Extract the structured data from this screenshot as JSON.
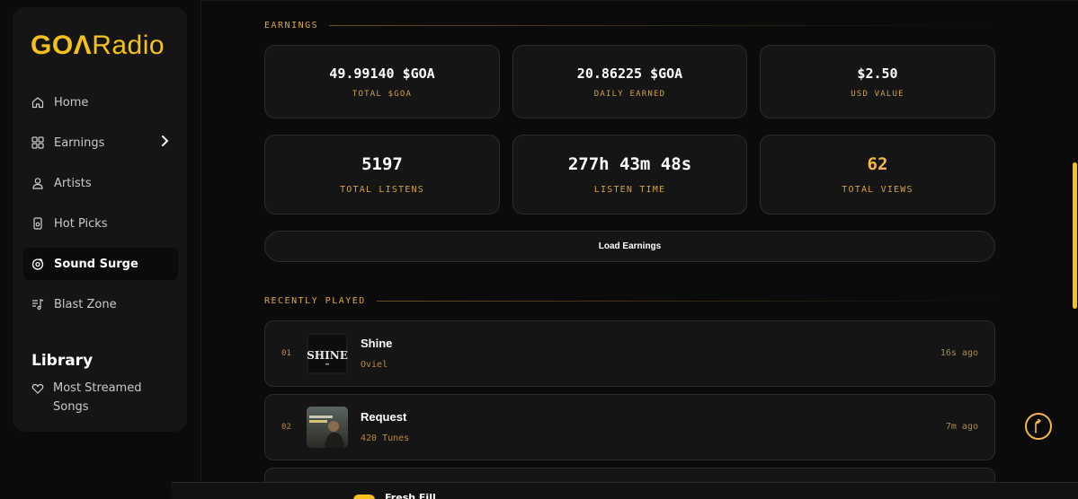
{
  "brand": {
    "logo_prefix": "GO",
    "logo_glyph": "Λ",
    "logo_suffix": "Radio",
    "accent": "#f6c21a"
  },
  "sidebar": {
    "items": [
      {
        "label": "Home",
        "icon": "home-icon"
      },
      {
        "label": "Earnings",
        "icon": "grid-icon",
        "chevron": true
      },
      {
        "label": "Artists",
        "icon": "user-icon"
      },
      {
        "label": "Hot Picks",
        "icon": "device-icon"
      },
      {
        "label": "Sound Surge",
        "icon": "disc-icon",
        "active": true
      },
      {
        "label": "Blast Zone",
        "icon": "music-list-icon"
      }
    ],
    "library_title": "Library",
    "library_items": [
      {
        "label": "Most Streamed Songs",
        "icon": "heart-icon"
      }
    ]
  },
  "earnings": {
    "header": "EARNINGS",
    "stats_row1": [
      {
        "value": "49.99140 $GOA",
        "label": "TOTAL $GOA"
      },
      {
        "value": "20.86225 $GOA",
        "label": "DAILY EARNED"
      },
      {
        "value": "$2.50",
        "label": "USD VALUE"
      }
    ],
    "stats_row2": [
      {
        "value": "5197",
        "label": "TOTAL LISTENS"
      },
      {
        "value": "277h 43m 48s",
        "label": "LISTEN TIME"
      },
      {
        "value": "62",
        "label": "TOTAL VIEWS"
      }
    ],
    "load_button": "Load Earnings"
  },
  "recently_played": {
    "header": "RECENTLY PLAYED",
    "tracks": [
      {
        "num": "01",
        "title": "Shine",
        "artist": "Oviel",
        "time": "16s ago",
        "art_text": "SHINE"
      },
      {
        "num": "02",
        "title": "Request",
        "artist": "420 Tunes",
        "time": "7m ago",
        "art_text": ""
      }
    ]
  },
  "player": {
    "title": "Fresh Fill"
  }
}
